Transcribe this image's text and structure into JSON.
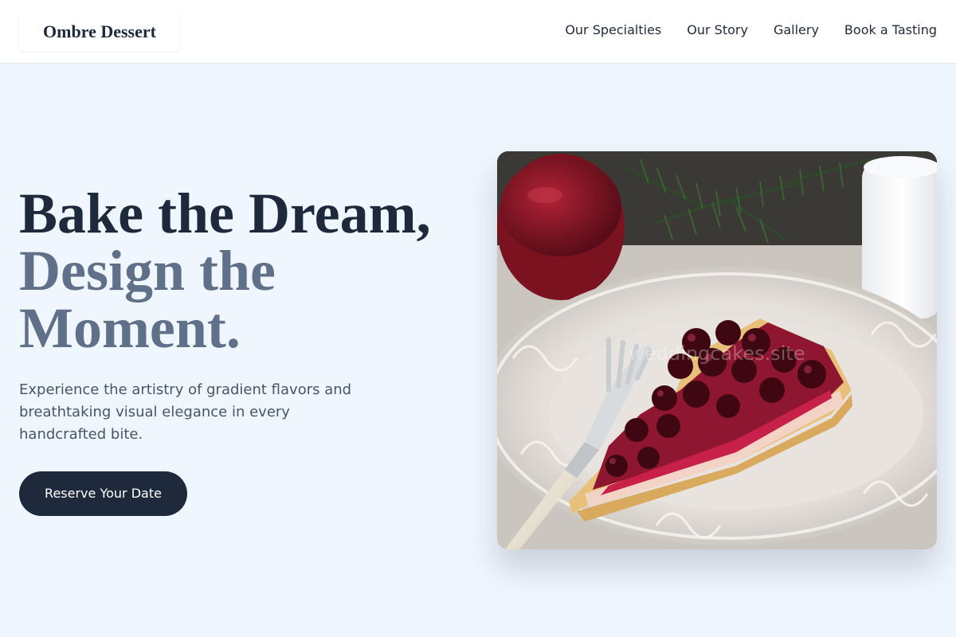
{
  "header": {
    "logo": "Ombre Dessert",
    "nav": [
      "Our Specialties",
      "Our Story",
      "Gallery",
      "Book a Tasting"
    ]
  },
  "hero": {
    "headline_line1": "Bake the Dream,",
    "headline_line2": "Design the",
    "headline_line3": "Moment.",
    "lead": "Experience the artistry of gradient flavors and breathtaking visual elegance in every handcrafted bite.",
    "cta_label": "Reserve Your Date",
    "image_watermark": "weddingcakes.site"
  },
  "colors": {
    "background": "#eff6fd",
    "text_dark": "#1e293b",
    "text_muted": "#5f7088",
    "body_text": "#475569",
    "button": "#1e293b"
  }
}
